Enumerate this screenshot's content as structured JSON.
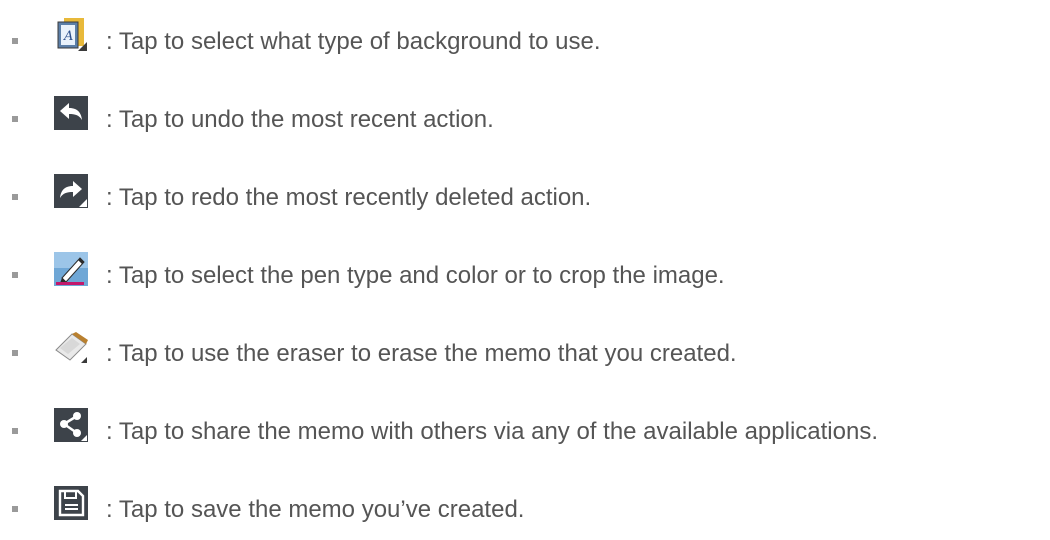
{
  "items": [
    {
      "icon": "background-type-icon",
      "text": ": Tap to select what type of background to use."
    },
    {
      "icon": "undo-arrow-icon",
      "text": ": Tap to undo the most recent action."
    },
    {
      "icon": "redo-arrow-icon",
      "text": ": Tap to redo the most recently deleted action."
    },
    {
      "icon": "pen-icon",
      "text": ": Tap to select the pen type and color or to crop the image."
    },
    {
      "icon": "eraser-icon",
      "text": ": Tap to use the eraser to erase the memo that you created."
    },
    {
      "icon": "share-icon",
      "text": ": Tap to share the memo with others via any of the available applications."
    },
    {
      "icon": "save-disk-icon",
      "text": ": Tap to save the memo you’ve created."
    }
  ],
  "colors": {
    "text": "#555555",
    "bullet": "#9a9a9a",
    "icon_bg": "#3d434a",
    "pen_accent": "#c2186b"
  }
}
